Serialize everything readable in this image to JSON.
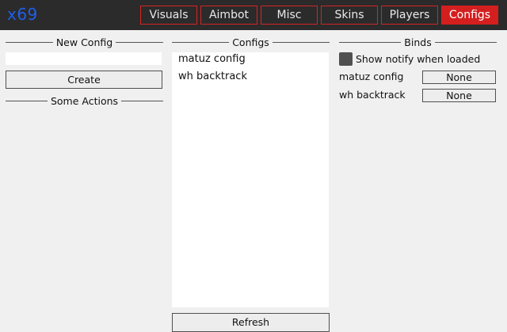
{
  "app": {
    "logo": "x69"
  },
  "tabs": [
    {
      "label": "Visuals",
      "active": false
    },
    {
      "label": "Aimbot",
      "active": false
    },
    {
      "label": "Misc",
      "active": false
    },
    {
      "label": "Skins",
      "active": false
    },
    {
      "label": "Players",
      "active": false
    },
    {
      "label": "Configs",
      "active": true
    }
  ],
  "new_config": {
    "title": "New Config",
    "input_value": "",
    "create_label": "Create",
    "actions_title": "Some Actions"
  },
  "configs": {
    "title": "Configs",
    "items": [
      "matuz config",
      "wh backtrack"
    ],
    "refresh_label": "Refresh"
  },
  "binds": {
    "title": "Binds",
    "notify_label": "Show notify when loaded",
    "notify_checked": false,
    "rows": [
      {
        "label": "matuz config",
        "key": "None"
      },
      {
        "label": "wh backtrack",
        "key": "None"
      }
    ]
  },
  "colors": {
    "accent": "#d41f1f",
    "logo": "#1f5fe8",
    "titlebar": "#2b2b2b",
    "panel": "#f0f0f0"
  }
}
